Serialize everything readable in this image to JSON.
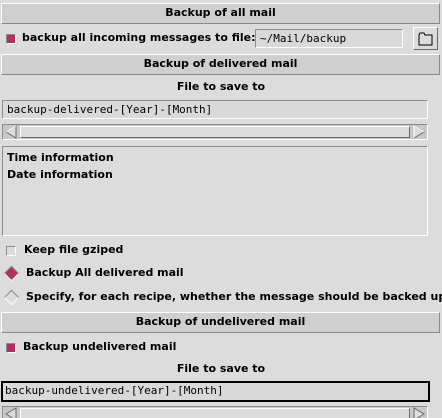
{
  "all_mail": {
    "title": "Backup of all mail",
    "checkbox_label": "backup all incoming messages to file:",
    "checkbox_checked": true,
    "file_value": "~/Mail/backup",
    "browse_icon": "folder-icon"
  },
  "delivered": {
    "title": "Backup of delivered mail",
    "file_heading": "File to save to",
    "file_value": "backup-delivered-[Year]-[Month]",
    "info_lines": [
      "Time information",
      "Date information"
    ],
    "gzip_label": "Keep file gziped",
    "gzip_checked": false,
    "radio_all_label": "Backup All delivered mail",
    "radio_all_selected": true,
    "radio_specify_label": "Specify, for each recipe, whether the message should be backed up",
    "radio_specify_selected": false
  },
  "undelivered": {
    "title": "Backup of undelivered mail",
    "checkbox_label": "Backup undelivered mail",
    "checkbox_checked": true,
    "file_heading": "File to save to",
    "file_value": "backup-undelivered-[Year]-[Month]"
  },
  "colors": {
    "accent": "#b03060",
    "background": "#dcdcdc"
  }
}
